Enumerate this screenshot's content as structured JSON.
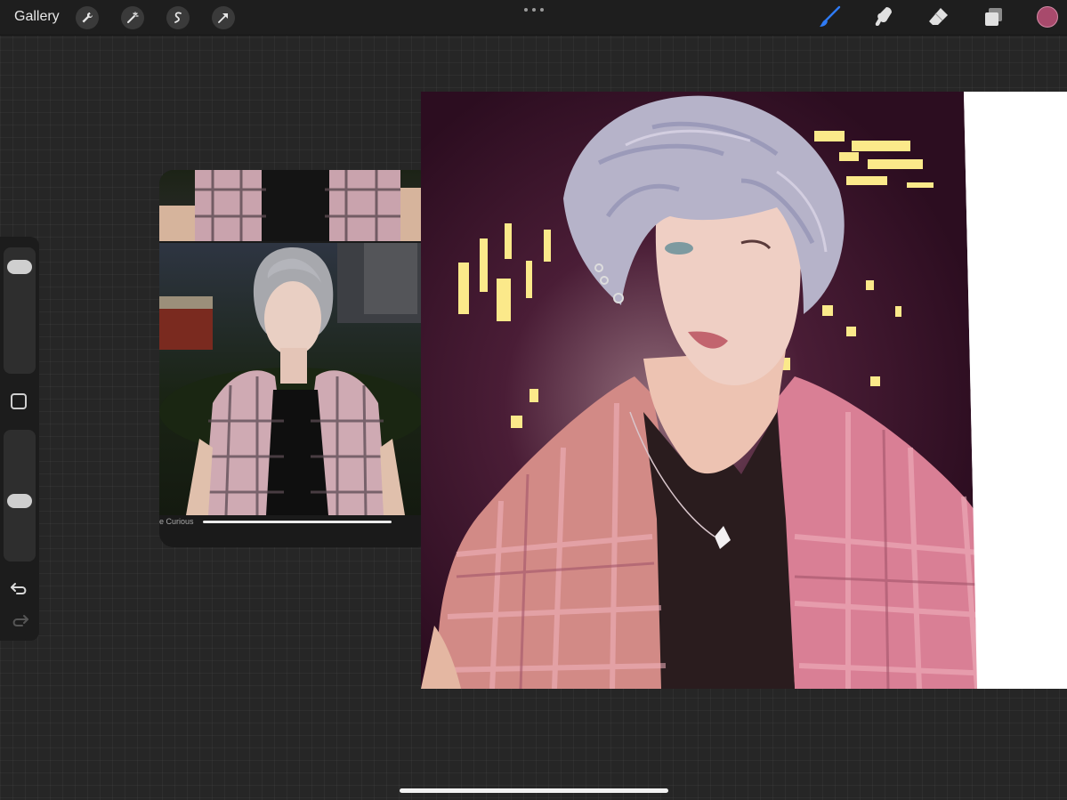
{
  "topbar": {
    "gallery_label": "Gallery",
    "left_tools": [
      "wrench-icon",
      "magic-wand-icon",
      "selection-icon",
      "transform-arrow-icon"
    ],
    "right_tools": [
      "brush-icon",
      "smudge-icon",
      "eraser-icon",
      "layers-icon"
    ],
    "active_tool": "brush-icon",
    "current_color": "#a84a6c",
    "accent_color": "#2f7bf5"
  },
  "sidebar": {
    "brush_size_level": 0.95,
    "brush_opacity_level": 0.45
  },
  "reference": {
    "caption": "e Curious"
  }
}
